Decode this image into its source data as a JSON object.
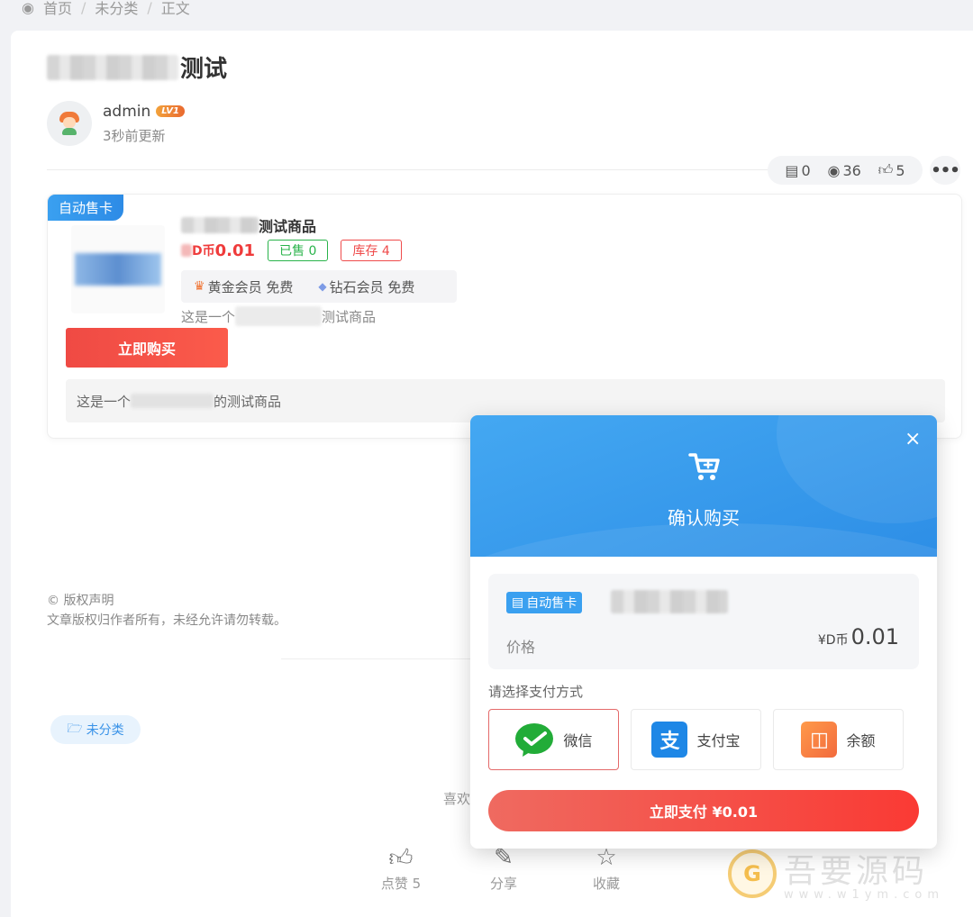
{
  "breadcrumb": {
    "home": "首页",
    "category": "未分类",
    "current": "正文"
  },
  "post": {
    "title_suffix": "测试",
    "author": "admin",
    "level": "LV1",
    "updated": "3秒前更新",
    "stats": {
      "comments": "0",
      "views": "36",
      "likes": "5"
    }
  },
  "product": {
    "tag": "自动售卡",
    "name_suffix": "测试商品",
    "currency": "D币",
    "price": "0.01",
    "sold": "已售 0",
    "stock": "库存 4",
    "vip_gold": "黄金会员 免费",
    "vip_diamond": "钻石会员 免费",
    "desc_prefix": "这是一个",
    "desc_suffix": "测试商品",
    "buy_label": "立即购买",
    "long_desc_prefix": "这是一个",
    "long_desc_suffix": "的测试商品"
  },
  "copyright": {
    "title": "© 版权声明",
    "text": "文章版权归作者所有，未经允许请勿转载。"
  },
  "category_tag": "未分类",
  "like_prompt": "喜欢",
  "actions": {
    "like": "点赞 5",
    "share": "分享",
    "collect": "收藏"
  },
  "watermark": {
    "name": "吾要源码",
    "url": "www.w1ym.com",
    "logo": "G"
  },
  "modal": {
    "close": "×",
    "title": "确认购买",
    "tag": "自动售卡",
    "price_label": "价格",
    "price_currency": "¥D币",
    "price_value": "0.01",
    "pay_prompt": "请选择支付方式",
    "methods": [
      {
        "label": "微信"
      },
      {
        "label": "支付宝"
      },
      {
        "label": "余额"
      }
    ],
    "pay_button": "立即支付  ¥0.01"
  },
  "colors": {
    "accent": "#2d8ee6",
    "danger": "#ef3b3b",
    "success": "#29b34a"
  }
}
